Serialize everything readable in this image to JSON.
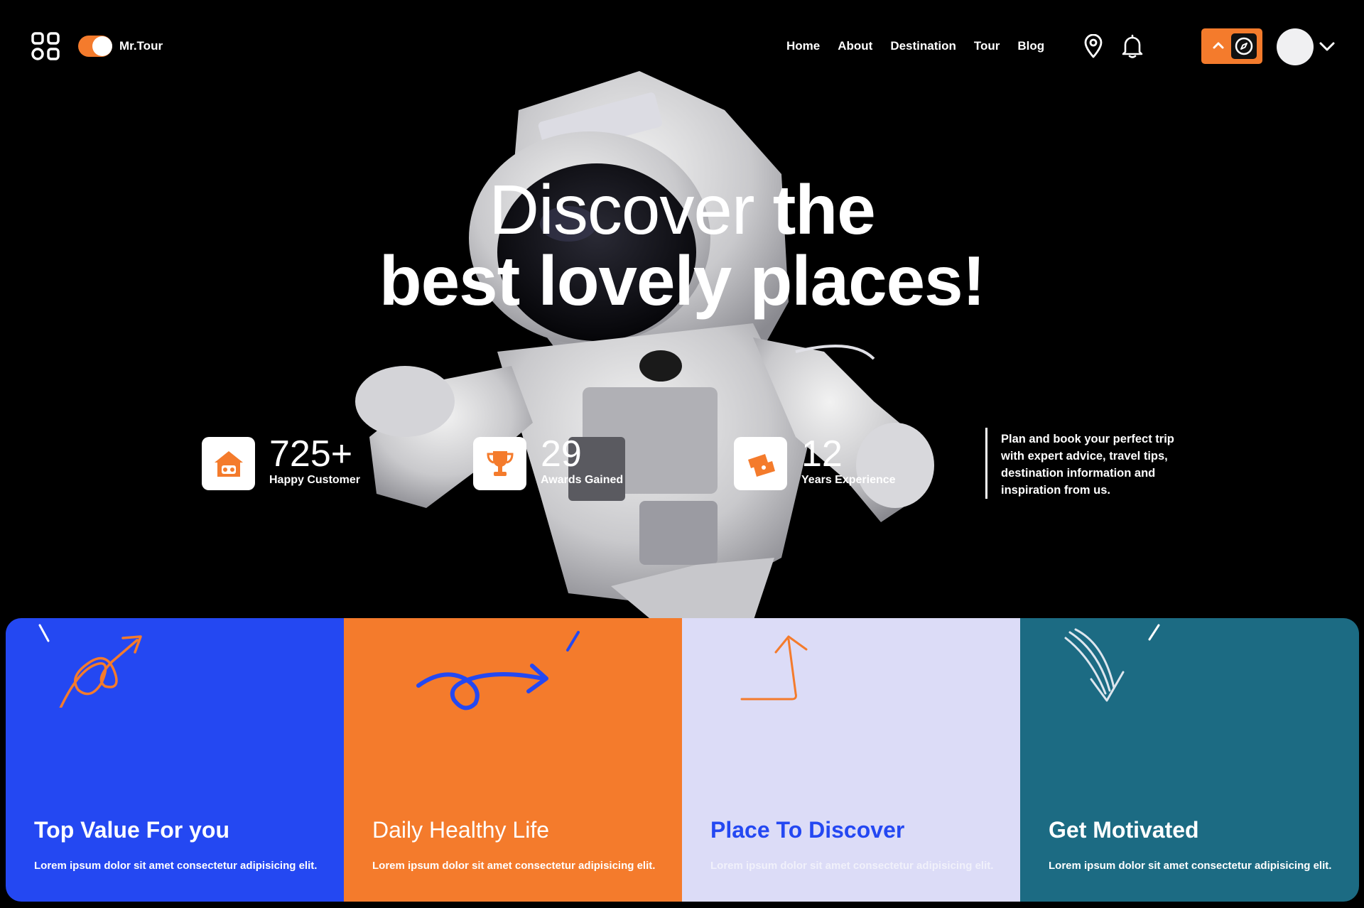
{
  "brand": {
    "name": "Mr.Tour"
  },
  "nav": {
    "items": [
      "Home",
      "About",
      "Destination",
      "Tour",
      "Blog"
    ]
  },
  "hero": {
    "title_light": "Discover",
    "title_bold": "the",
    "title_line2": "best lovely places!",
    "stats": [
      {
        "value": "725+",
        "label": "Happy Customer",
        "icon": "house-icon"
      },
      {
        "value": "29",
        "label": "Awards Gained",
        "icon": "trophy-icon"
      },
      {
        "value": "12",
        "label": "Years Experience",
        "icon": "tickets-icon"
      }
    ],
    "blurb": "Plan and book your perfect trip with expert advice, travel tips, destination information and inspiration from us."
  },
  "cards": [
    {
      "title": "Top Value For you",
      "text": "Lorem ipsum dolor sit amet consectetur adipisicing elit.",
      "bg": "#2448f2"
    },
    {
      "title": "Daily Healthy Life",
      "text": "Lorem ipsum dolor sit amet consectetur adipisicing elit.",
      "bg": "#f47b2c"
    },
    {
      "title": "Place To Discover",
      "text": "Lorem ipsum dolor sit amet consectetur adipisicing elit.",
      "bg": "#dcdcf7"
    },
    {
      "title": "Get Motivated",
      "text": "Lorem ipsum dolor sit amet consectetur adipisicing elit.",
      "bg": "#1c6b83"
    }
  ],
  "colors": {
    "accent": "#f47b2c",
    "blue": "#2448f2",
    "teal": "#1c6b83",
    "lavender": "#dcdcf7"
  }
}
